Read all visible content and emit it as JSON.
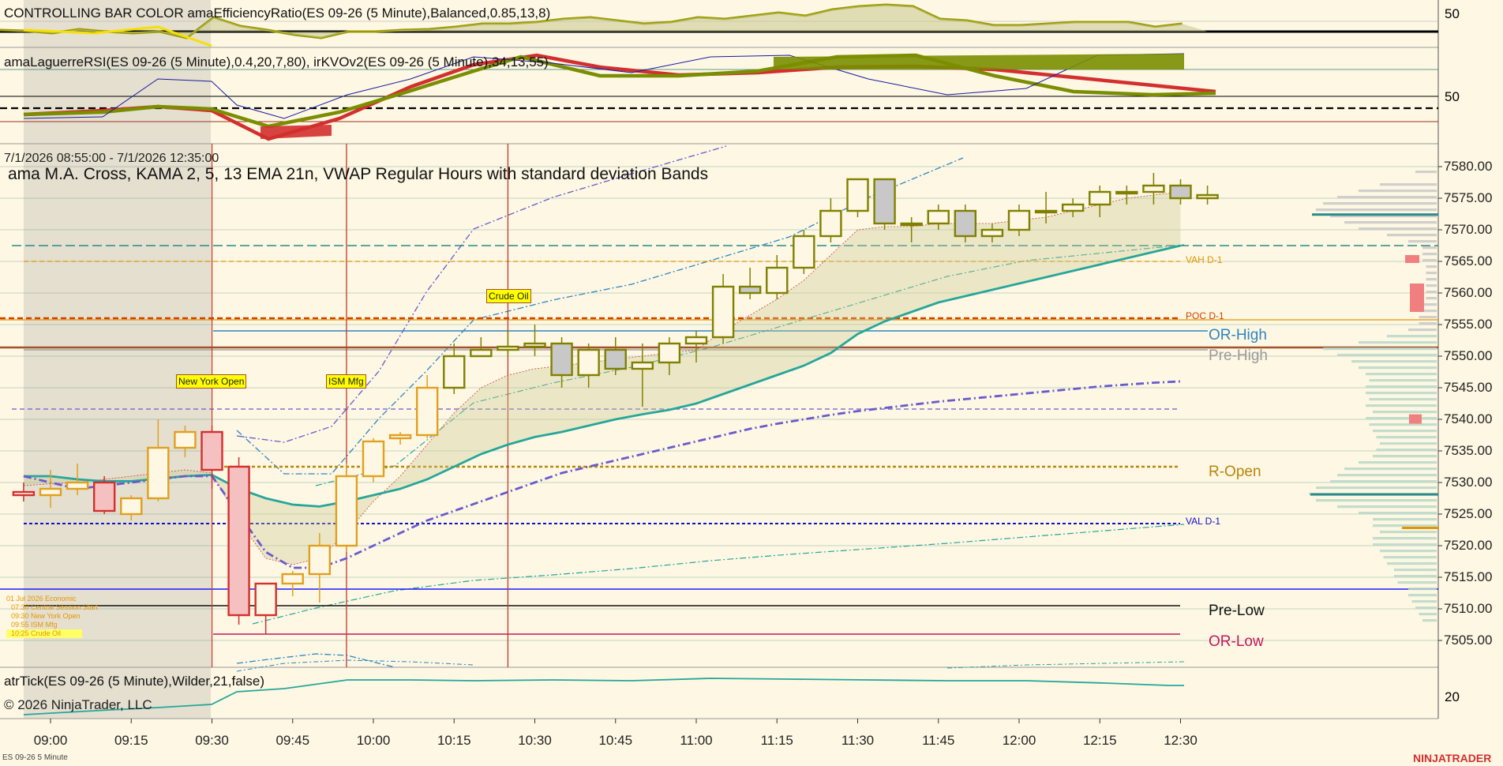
{
  "panels": {
    "efficiency_title": "CONTROLLING BAR COLOR amaEfficiencyRatio(ES 09-26 (5 Minute),Balanced,0.85,13,8)",
    "efficiency_axis": "50",
    "laguerre_title": "amaLaguerreRSI(ES 09-26 (5 Minute),0.4,20,7,80), irKVOv2(ES 09-26 (5 Minute),34,13,55)",
    "laguerre_axis": "50",
    "date_range": "7/1/2026 08:55:00 - 7/1/2026 12:35:00",
    "price_title": "ama M.A. Cross,  KAMA  2, 5, 13 EMA 21n, VWAP Regular Hours with standard deviation Bands",
    "atr_title": "atrTick(ES 09-26 (5 Minute),Wilder,21,false)",
    "atr_axis": "20",
    "copyright": "© 2026 NinjaTrader, LLC",
    "instrument": "ES 09-26 5 Minute",
    "brand": "NINJATRADER"
  },
  "annotations": [
    {
      "label": "New York Open",
      "time": "09:30"
    },
    {
      "label": "ISM Mfg",
      "time": "09:55"
    },
    {
      "label": "Crude Oil",
      "time": "10:25"
    }
  ],
  "event_list": [
    "01 Jul 2026 Economic",
    "07:30 Central Session Start",
    "09:30 New York Open",
    "09:55 ISM Mfg",
    "10:25 Crude Oil"
  ],
  "levels": [
    {
      "label": "VAH D-1",
      "price": 7565,
      "color": "#e69500"
    },
    {
      "label": "POC D-1",
      "price": 7556,
      "color": "#d04000"
    },
    {
      "label": "OR-High",
      "price": 7554,
      "color": "#2e86c1"
    },
    {
      "label": "Pre-High",
      "price": 7551,
      "color": "#999999"
    },
    {
      "label": "R-Open",
      "price": 7532.5,
      "color": "#b8860b"
    },
    {
      "label": "VAL D-1",
      "price": 7523.5,
      "color": "#1010cc"
    },
    {
      "label": "Pre-Low",
      "price": 7510.5,
      "color": "#111111"
    },
    {
      "label": "OR-Low",
      "price": 7506,
      "color": "#c2185b"
    }
  ],
  "colors": {
    "background": "#fdf7e3",
    "bull_candle": "#808000",
    "bear_candle": "#8b8b00",
    "red_candle": "#d32f2f",
    "ema": "#26a69a",
    "vwap": "#6a5acd",
    "grid": "#2f7f6f"
  },
  "chart_data": {
    "type": "candlestick",
    "title": "ama M.A. Cross,  KAMA  2, 5, 13 EMA 21n, VWAP Regular Hours with standard deviation Bands",
    "y_ticks": [
      7580,
      7575,
      7570,
      7565,
      7560,
      7555,
      7550,
      7545,
      7540,
      7535,
      7530,
      7525,
      7520,
      7515,
      7510,
      7505
    ],
    "x_ticks": [
      "09:00",
      "09:15",
      "09:30",
      "09:45",
      "10:00",
      "10:15",
      "10:30",
      "10:45",
      "11:00",
      "11:15",
      "11:30",
      "11:45",
      "12:00",
      "12:15",
      "12:30"
    ],
    "ylim": [
      7502,
      7582
    ],
    "candles": [
      {
        "t": "08:55",
        "o": 7528,
        "h": 7530,
        "l": 7527,
        "c": 7528.5
      },
      {
        "t": "09:00",
        "o": 7528,
        "h": 7532,
        "l": 7526,
        "c": 7529
      },
      {
        "t": "09:05",
        "o": 7529,
        "h": 7533,
        "l": 7528,
        "c": 7530
      },
      {
        "t": "09:10",
        "o": 7530,
        "h": 7531,
        "l": 7525,
        "c": 7525.5
      },
      {
        "t": "09:15",
        "o": 7525,
        "h": 7528,
        "l": 7524,
        "c": 7527.5
      },
      {
        "t": "09:20",
        "o": 7527.5,
        "h": 7540,
        "l": 7527,
        "c": 7535.5
      },
      {
        "t": "09:25",
        "o": 7535.5,
        "h": 7539,
        "l": 7534,
        "c": 7538
      },
      {
        "t": "09:30",
        "o": 7538,
        "h": 7539,
        "l": 7529,
        "c": 7532
      },
      {
        "t": "09:35",
        "o": 7532.5,
        "h": 7534,
        "l": 7507.5,
        "c": 7509
      },
      {
        "t": "09:40",
        "o": 7509,
        "h": 7514,
        "l": 7506,
        "c": 7514
      },
      {
        "t": "09:45",
        "o": 7514,
        "h": 7516,
        "l": 7512,
        "c": 7515.5
      },
      {
        "t": "09:50",
        "o": 7515.5,
        "h": 7522,
        "l": 7511,
        "c": 7520
      },
      {
        "t": "09:55",
        "o": 7520,
        "h": 7533,
        "l": 7519,
        "c": 7531
      },
      {
        "t": "10:00",
        "o": 7531,
        "h": 7537,
        "l": 7530,
        "c": 7536.5
      },
      {
        "t": "10:05",
        "o": 7537,
        "h": 7538,
        "l": 7536,
        "c": 7537.5
      },
      {
        "t": "10:10",
        "o": 7537.5,
        "h": 7547,
        "l": 7537,
        "c": 7545
      },
      {
        "t": "10:15",
        "o": 7545,
        "h": 7552,
        "l": 7544,
        "c": 7550
      },
      {
        "t": "10:20",
        "o": 7550,
        "h": 7553,
        "l": 7550,
        "c": 7551
      },
      {
        "t": "10:25",
        "o": 7551,
        "h": 7554,
        "l": 7550,
        "c": 7551.5
      },
      {
        "t": "10:30",
        "o": 7551.5,
        "h": 7555,
        "l": 7550,
        "c": 7552
      },
      {
        "t": "10:35",
        "o": 7552,
        "h": 7553,
        "l": 7545,
        "c": 7547
      },
      {
        "t": "10:40",
        "o": 7547,
        "h": 7552,
        "l": 7545,
        "c": 7551
      },
      {
        "t": "10:45",
        "o": 7551,
        "h": 7553,
        "l": 7547,
        "c": 7548
      },
      {
        "t": "10:50",
        "o": 7548,
        "h": 7552,
        "l": 7542,
        "c": 7549
      },
      {
        "t": "10:55",
        "o": 7549,
        "h": 7553,
        "l": 7547,
        "c": 7552
      },
      {
        "t": "11:00",
        "o": 7552,
        "h": 7554,
        "l": 7549,
        "c": 7553
      },
      {
        "t": "11:05",
        "o": 7553,
        "h": 7563,
        "l": 7552,
        "c": 7561
      },
      {
        "t": "11:10",
        "o": 7561,
        "h": 7564,
        "l": 7559,
        "c": 7560
      },
      {
        "t": "11:15",
        "o": 7560,
        "h": 7566,
        "l": 7559,
        "c": 7564
      },
      {
        "t": "11:20",
        "o": 7564,
        "h": 7570,
        "l": 7563,
        "c": 7569
      },
      {
        "t": "11:25",
        "o": 7569,
        "h": 7575,
        "l": 7568,
        "c": 7573
      },
      {
        "t": "11:30",
        "o": 7573,
        "h": 7578,
        "l": 7572,
        "c": 7578
      },
      {
        "t": "11:35",
        "o": 7578,
        "h": 7578,
        "l": 7570,
        "c": 7571
      },
      {
        "t": "11:40",
        "o": 7571,
        "h": 7572,
        "l": 7568,
        "c": 7571
      },
      {
        "t": "11:45",
        "o": 7571,
        "h": 7574,
        "l": 7570,
        "c": 7573
      },
      {
        "t": "11:50",
        "o": 7573,
        "h": 7574,
        "l": 7568,
        "c": 7569
      },
      {
        "t": "11:55",
        "o": 7569,
        "h": 7571,
        "l": 7568,
        "c": 7570
      },
      {
        "t": "12:00",
        "o": 7570,
        "h": 7574,
        "l": 7569,
        "c": 7573
      },
      {
        "t": "12:05",
        "o": 7573,
        "h": 7576,
        "l": 7571,
        "c": 7573
      },
      {
        "t": "12:10",
        "o": 7573,
        "h": 7575,
        "l": 7572,
        "c": 7574
      },
      {
        "t": "12:15",
        "o": 7574,
        "h": 7577,
        "l": 7572,
        "c": 7576
      },
      {
        "t": "12:20",
        "o": 7576,
        "h": 7577,
        "l": 7574,
        "c": 7576
      },
      {
        "t": "12:25",
        "o": 7576,
        "h": 7579,
        "l": 7574,
        "c": 7577
      },
      {
        "t": "12:30",
        "o": 7577,
        "h": 7578,
        "l": 7574,
        "c": 7575
      },
      {
        "t": "12:35",
        "o": 7575,
        "h": 7577,
        "l": 7574,
        "c": 7575.5
      }
    ],
    "ema": [
      7531,
      7531,
      7530.5,
      7530.2,
      7530.2,
      7530.6,
      7531,
      7531.2,
      7529,
      7527.5,
      7526.5,
      7526.2,
      7527,
      7528,
      7529,
      7530.5,
      7532.5,
      7534.5,
      7536,
      7537.2,
      7538,
      7539,
      7540,
      7540.8,
      7541.5,
      7542.5,
      7544,
      7545.5,
      7547,
      7548.5,
      7550.5,
      7553.5,
      7555.5,
      7557,
      7558.5,
      7559.5,
      7560.5,
      7561.5,
      7562.5,
      7563.5,
      7564.5,
      7565.5,
      7566.5,
      7567.5
    ],
    "vwap": [
      7531,
      7530,
      7529,
      7529.5,
      7530,
      7530.5,
      7531,
      7531,
      7525,
      7519,
      7516.5,
      7516.5,
      7518,
      7520,
      7522,
      7524,
      7525.5,
      7527,
      7528.5,
      7530,
      7531.5,
      7532.5,
      7533.5,
      7534.5,
      7535.5,
      7536.5,
      7537.5,
      7538.5,
      7539.3,
      7540,
      7540.7,
      7541.3,
      7541.8,
      7542.3,
      7542.8,
      7543.2,
      7543.6,
      7544,
      7544.4,
      7544.8,
      7545.2,
      7545.5,
      7545.8,
      7546
    ]
  }
}
